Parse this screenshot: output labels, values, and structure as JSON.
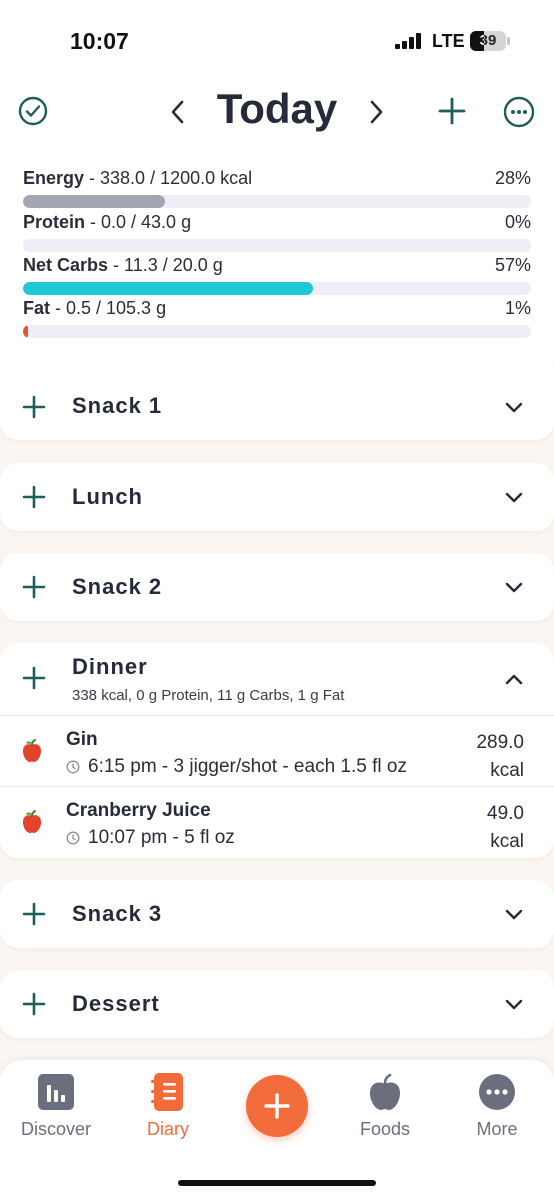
{
  "status_bar": {
    "time": "10:07",
    "network": "LTE",
    "battery_level": "39"
  },
  "header": {
    "title": "Today"
  },
  "nutrition": [
    {
      "label": "Energy",
      "detail": " - 338.0 / 1200.0 kcal",
      "percent_text": "28%",
      "fraction": 0.28,
      "color": "#a4a6b4"
    },
    {
      "label": "Protein",
      "detail": " - 0.0 / 43.0 g",
      "percent_text": "0%",
      "fraction": 0.0,
      "color": "#a4a6b4"
    },
    {
      "label": "Net Carbs",
      "detail": " - 11.3 / 20.0 g",
      "percent_text": "57%",
      "fraction": 0.57,
      "color": "#1ec8d4"
    },
    {
      "label": "Fat",
      "detail": " - 0.5 / 105.3 g",
      "percent_text": "1%",
      "fraction": 0.01,
      "color": "#e4572e"
    }
  ],
  "pager": {
    "count": 4,
    "active": 1
  },
  "meals": {
    "snack1": {
      "name": "Snack 1"
    },
    "lunch": {
      "name": "Lunch"
    },
    "snack2": {
      "name": "Snack 2"
    },
    "dinner": {
      "name": "Dinner",
      "summary": "338 kcal, 0 g Protein, 11 g Carbs, 1 g Fat",
      "foods": [
        {
          "name": "Gin",
          "detail": "6:15 pm - 3 jigger/shot - each 1.5 fl oz",
          "kcal_value": "289.0",
          "kcal_unit": "kcal"
        },
        {
          "name": "Cranberry Juice",
          "detail": "10:07 pm - 5 fl oz",
          "kcal_value": "49.0",
          "kcal_unit": "kcal"
        }
      ]
    },
    "snack3": {
      "name": "Snack 3"
    },
    "dessert": {
      "name": "Dessert"
    }
  },
  "tabbar": {
    "discover": "Discover",
    "diary": "Diary",
    "foods": "Foods",
    "more": "More"
  },
  "colors": {
    "accent": "#f26b3a",
    "teal": "#1d5e59",
    "carbs": "#1ec8d4"
  }
}
